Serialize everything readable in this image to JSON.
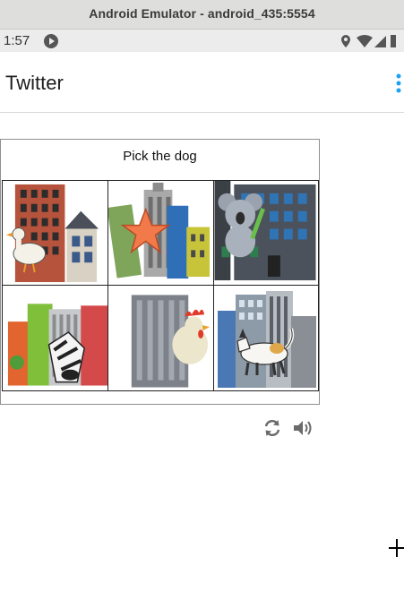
{
  "window": {
    "title": "Android Emulator - android_435:5554"
  },
  "statusbar": {
    "time": "1:57"
  },
  "appbar": {
    "title": "Twitter"
  },
  "captcha": {
    "prompt": "Pick the dog",
    "tiles": [
      {
        "subject": "duck"
      },
      {
        "subject": "starfish"
      },
      {
        "subject": "koala"
      },
      {
        "subject": "zebra"
      },
      {
        "subject": "rooster"
      },
      {
        "subject": "dog"
      }
    ],
    "controls": {
      "refresh_icon": "refresh-icon",
      "audio_icon": "speaker-icon"
    }
  },
  "colors": {
    "menu_accent": "#1da1f2"
  }
}
